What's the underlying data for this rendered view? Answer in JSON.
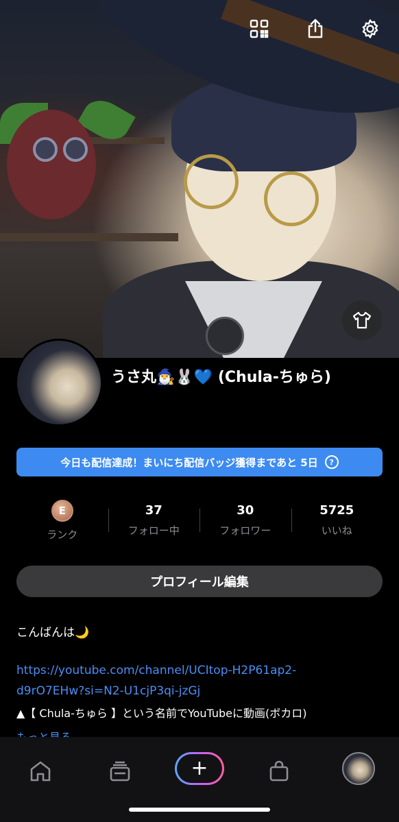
{
  "profile": {
    "username": "うさ丸🧙‍♂️🐰💙 (Chula-ちゅら)",
    "streak_banner": "今日も配信達成！まいにち配信バッジ獲得まであと 5日",
    "help_symbol": "?",
    "edit_button": "プロフィール編集"
  },
  "stats": {
    "rank_letter": "E",
    "rank_label": "ランク",
    "following_value": "37",
    "following_label": "フォロー中",
    "followers_value": "30",
    "followers_label": "フォロワー",
    "likes_value": "5725",
    "likes_label": "いいね"
  },
  "bio": {
    "line1": "こんばんは🌙",
    "link_line1": "https://youtube.com/channel/UCItop-H2P61ap2-",
    "link_line2": "d9rO7EHw?si=N2-U1cjP3qi-jzGj",
    "line3": "▲【 Chula-ちゅら 】という名前でYouTubeに動画(ボカロ)",
    "more": "もっと見る"
  },
  "icons": {
    "top": [
      "qr-code-icon",
      "share-icon",
      "gear-icon"
    ],
    "outfit": "shirt-icon",
    "tabs": [
      "home-icon",
      "feed-icon",
      "plus-icon",
      "bag-icon",
      "avatar"
    ]
  },
  "colors": {
    "accent": "#3d8bf0",
    "link": "#4a8ff5",
    "background": "#000000"
  }
}
